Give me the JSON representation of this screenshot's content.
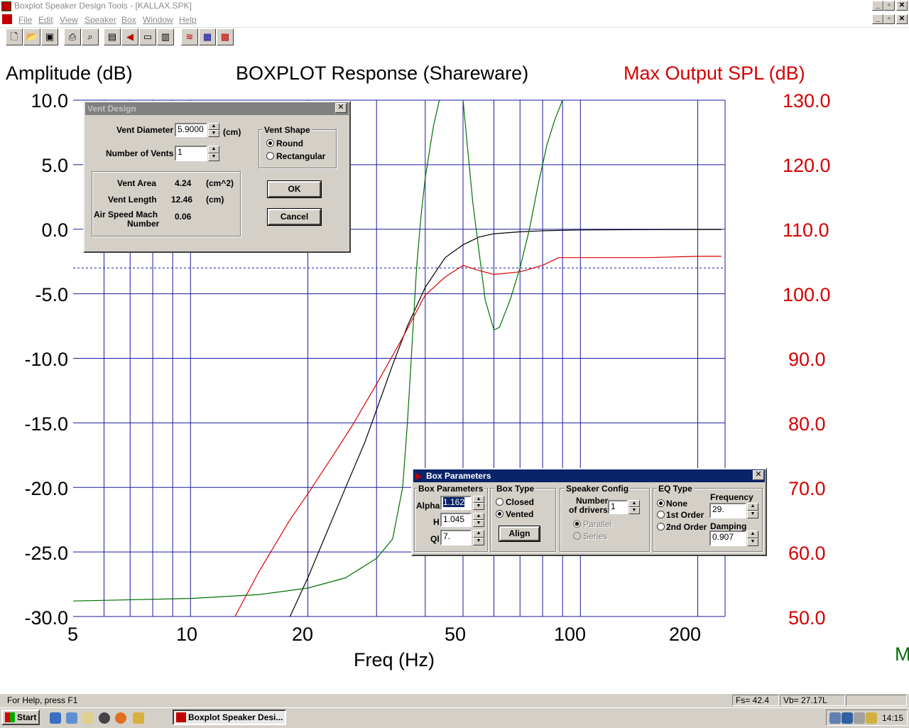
{
  "window": {
    "title": "Boxplot Speaker Design Tools - [KALLAX.SPK]",
    "controls": [
      "_",
      "▫",
      "✕"
    ]
  },
  "menu": [
    "File",
    "Edit",
    "View",
    "Speaker",
    "Box",
    "Window",
    "Help"
  ],
  "toolbar": [
    "new-icon",
    "open-icon",
    "save-icon",
    "print-icon",
    "preview-icon",
    "driver-icon",
    "speaker-icon",
    "box-icon",
    "graph-icon",
    "filter-icon",
    "passive-icon",
    "active-icon"
  ],
  "chart": {
    "left_axis_title": "Amplitude (dB)",
    "title": "BOXPLOT  Response (Shareware)",
    "right_axis_title": "Max Output SPL (dB)",
    "x_label": "Freq (Hz)",
    "y_ticks": [
      "10.0",
      "5.0",
      "0.0",
      "-5.0",
      "-10.0",
      "-15.0",
      "-20.0",
      "-25.0",
      "-30.0"
    ],
    "y2_ticks": [
      "130.0",
      "120.0",
      "110.0",
      "100.0",
      "90.0",
      "80.0",
      "70.0",
      "60.0",
      "50.0"
    ],
    "x_ticks": [
      "5",
      "10",
      "20",
      "50",
      "100",
      "200"
    ],
    "clipped_right_label": "M",
    "colors": {
      "axis_text": "#000000",
      "right_axis": "#d40000",
      "grid": "#1a1aa0",
      "black_curve": "#000000",
      "red_curve": "#dd0000",
      "green_curve": "#007000"
    }
  },
  "chart_data": {
    "type": "line",
    "title": "BOXPLOT  Response (Shareware)",
    "xlabel": "Freq (Hz)",
    "ylabel": "Amplitude (dB)",
    "y2label": "Max Output SPL (dB)",
    "xscale": "log",
    "xlim": [
      5,
      235
    ],
    "ylim": [
      -30,
      10
    ],
    "y2lim": [
      50,
      130
    ],
    "grid": true,
    "reference_line_db": -3,
    "series": [
      {
        "axis": "left",
        "color": "#000000",
        "x": [
          18,
          20,
          22,
          25,
          28,
          30,
          33,
          36,
          40,
          45,
          50,
          55,
          60,
          70,
          80,
          100,
          150,
          200,
          230
        ],
        "y": [
          -30,
          -27,
          -24,
          -20,
          -16.5,
          -14,
          -10.5,
          -7.5,
          -4.5,
          -2.2,
          -1.2,
          -0.6,
          -0.35,
          -0.2,
          -0.12,
          -0.06,
          -0.03,
          -0.02,
          -0.02
        ]
      },
      {
        "axis": "left",
        "color": "#dd0000",
        "x": [
          13,
          15,
          18,
          20,
          23,
          26,
          30,
          35,
          40,
          45,
          50,
          55,
          60,
          70,
          80,
          88,
          100,
          150,
          200,
          230
        ],
        "y": [
          -30,
          -26.5,
          -22.5,
          -20.5,
          -17.7,
          -15.2,
          -12,
          -8.4,
          -5.1,
          -3.7,
          -2.8,
          -3.2,
          -3.5,
          -3.3,
          -2.8,
          -2.2,
          -2.2,
          -2.2,
          -2.1,
          -2.1
        ]
      },
      {
        "axis": "left",
        "color": "#007000",
        "x": [
          5,
          10,
          15,
          20,
          25,
          30,
          33,
          35,
          36,
          37,
          38,
          39,
          40,
          42,
          45,
          48,
          50,
          53,
          57,
          60,
          62,
          66,
          70,
          74,
          78,
          82,
          86,
          90
        ],
        "y": [
          -28.8,
          -28.6,
          -28.3,
          -27.8,
          -27,
          -25.5,
          -24,
          -20,
          -15,
          -9,
          -3,
          1,
          4,
          8,
          12,
          12,
          10,
          2,
          -5.5,
          -7.8,
          -7.6,
          -5.5,
          -3,
          0,
          3.5,
          6.5,
          8.5,
          10
        ]
      }
    ]
  },
  "vent_dialog": {
    "title": "Vent Design",
    "diameter_label": "Vent Diameter",
    "diameter_value": "5.9000",
    "diameter_unit": "(cm)",
    "num_vents_label": "Number of Vents",
    "num_vents_value": "1",
    "shape_group": "Vent Shape",
    "shape_round": "Round",
    "shape_rect": "Rectangular",
    "area_label": "Vent Area",
    "area_value": "4.24",
    "area_unit": "(cm^2)",
    "length_label": "Vent Length",
    "length_value": "12.46",
    "length_unit": "(cm)",
    "mach_label1": "Air Speed Mach",
    "mach_label2": "Number",
    "mach_value": "0.06",
    "ok": "OK",
    "cancel": "Cancel"
  },
  "box_dialog": {
    "title": "Box Parameters",
    "params_group": "Box Parameters",
    "alpha_label": "Alpha",
    "alpha_value": "1.162",
    "h_label": "H",
    "h_value": "1.045",
    "ql_label": "Ql",
    "ql_value": "7.",
    "type_group": "Box Type",
    "closed": "Closed",
    "vented": "Vented",
    "align": "Align",
    "config_group": "Speaker Config",
    "num_label1": "Number",
    "num_label2": "of drivers",
    "num_value": "1",
    "parallel": "Parallel",
    "series": "Series",
    "eq_group": "EQ Type",
    "eq_none": "None",
    "eq_1st": "1st Order",
    "eq_2nd": "2nd Order",
    "freq_label": "Frequency",
    "freq_value": "29.",
    "damping_label": "Damping",
    "damping_value": "0.907"
  },
  "status": {
    "help": "For Help, press F1",
    "fs": "Fs= 42.4",
    "vb": "Vb= 27.17L"
  },
  "taskbar": {
    "start": "Start",
    "task": "Boxplot Speaker Desi...",
    "clock": "14:15"
  }
}
